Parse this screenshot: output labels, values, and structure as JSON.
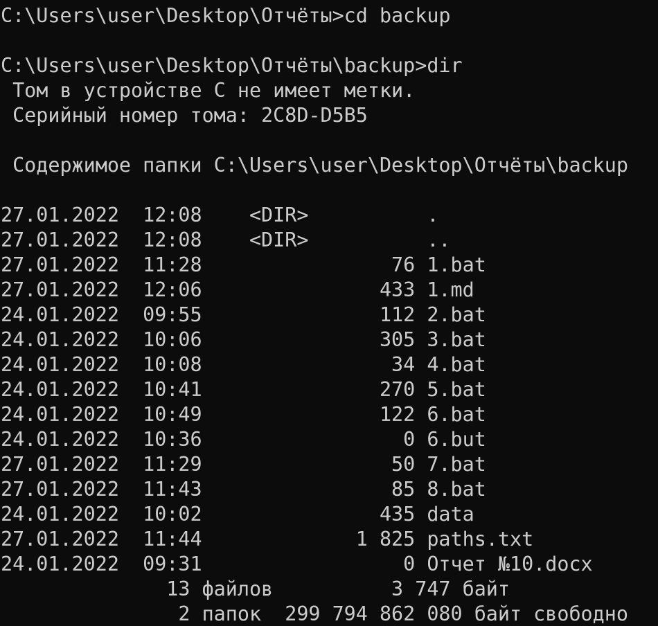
{
  "terminal": {
    "background_color": "#0c0c0c",
    "text_color": "#cccccc",
    "lines": [
      "C:\\Users\\user\\Desktop\\Отчёты>cd backup",
      "",
      "C:\\Users\\user\\Desktop\\Отчёты\\backup>dir",
      " Том в устройстве C не имеет метки.",
      " Серийный номер тома: 2C8D-D5B5",
      "",
      " Содержимое папки C:\\Users\\user\\Desktop\\Отчёты\\backup",
      "",
      "27.01.2022  12:08    <DIR>          .",
      "27.01.2022  12:08    <DIR>          ..",
      "27.01.2022  11:28                76 1.bat",
      "27.01.2022  12:06               433 1.md",
      "24.01.2022  09:55               112 2.bat",
      "24.01.2022  10:06               305 3.bat",
      "24.01.2022  10:08                34 4.bat",
      "24.01.2022  10:41               270 5.bat",
      "24.01.2022  10:49               122 6.bat",
      "24.01.2022  10:36                 0 6.but",
      "27.01.2022  11:29                50 7.bat",
      "27.01.2022  11:43                85 8.bat",
      "24.01.2022  10:02               435 data",
      "27.01.2022  11:44             1 825 paths.txt",
      "24.01.2022  09:31                 0 Отчет №10.docx",
      "              13 файлов          3 747 байт",
      "               2 папок  299 794 862 080 байт свободно"
    ]
  }
}
